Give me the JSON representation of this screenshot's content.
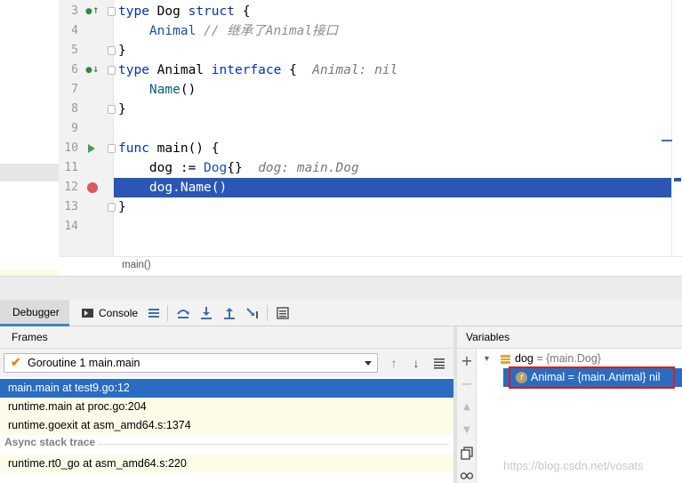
{
  "editor": {
    "lines": [
      {
        "num": "3",
        "tokens": [
          [
            "kw",
            "type"
          ],
          [
            "",
            "Dog"
          ],
          [
            "kw",
            "struct"
          ],
          [
            "",
            "{"
          ]
        ]
      },
      {
        "num": "4",
        "tokens": [
          [
            "tp",
            "Animal"
          ],
          [
            "cm",
            "// 继承了Animal接口"
          ]
        ]
      },
      {
        "num": "5",
        "tokens": [
          [
            "",
            "}"
          ]
        ]
      },
      {
        "num": "6",
        "tokens": [
          [
            "kw",
            "type"
          ],
          [
            "",
            "Animal"
          ],
          [
            "kw",
            "interface"
          ],
          [
            "",
            "{"
          ],
          [
            "hint",
            "Animal: nil"
          ]
        ]
      },
      {
        "num": "7",
        "tokens": [
          [
            "fn",
            "Name"
          ],
          [
            "",
            "()"
          ]
        ]
      },
      {
        "num": "8",
        "tokens": [
          [
            "",
            "}"
          ]
        ]
      },
      {
        "num": "9",
        "tokens": []
      },
      {
        "num": "10",
        "tokens": [
          [
            "kw",
            "func"
          ],
          [
            "",
            "main() {"
          ]
        ]
      },
      {
        "num": "11",
        "tokens": [
          [
            "",
            "dog :="
          ],
          [
            "tp",
            "Dog"
          ],
          [
            "",
            "{}"
          ],
          [
            "hint",
            "dog: main.Dog"
          ]
        ]
      },
      {
        "num": "12",
        "tokens": [
          [
            "",
            "dog.Name()"
          ]
        ]
      },
      {
        "num": "13",
        "tokens": [
          [
            "",
            "}"
          ]
        ]
      },
      {
        "num": "14",
        "tokens": []
      }
    ],
    "breadcrumb": "main()"
  },
  "toolbar": {
    "debugger_tab": "Debugger",
    "console_tab": "Console"
  },
  "frames": {
    "title": "Frames",
    "goroutine": "Goroutine 1 main.main",
    "items": [
      "main.main at test9.go:12",
      "runtime.main at proc.go:204",
      "runtime.goexit at asm_amd64.s:1374"
    ],
    "async_label": "Async stack trace",
    "async_items": [
      "runtime.rt0_go at asm_amd64.s:220"
    ]
  },
  "variables": {
    "title": "Variables",
    "dog_name": "dog",
    "dog_value": "= {main.Dog}",
    "animal_field": "Animal = {main.Animal} nil",
    "field_badge": "f"
  },
  "watermark": "https://blog.csdn.net/vosats"
}
